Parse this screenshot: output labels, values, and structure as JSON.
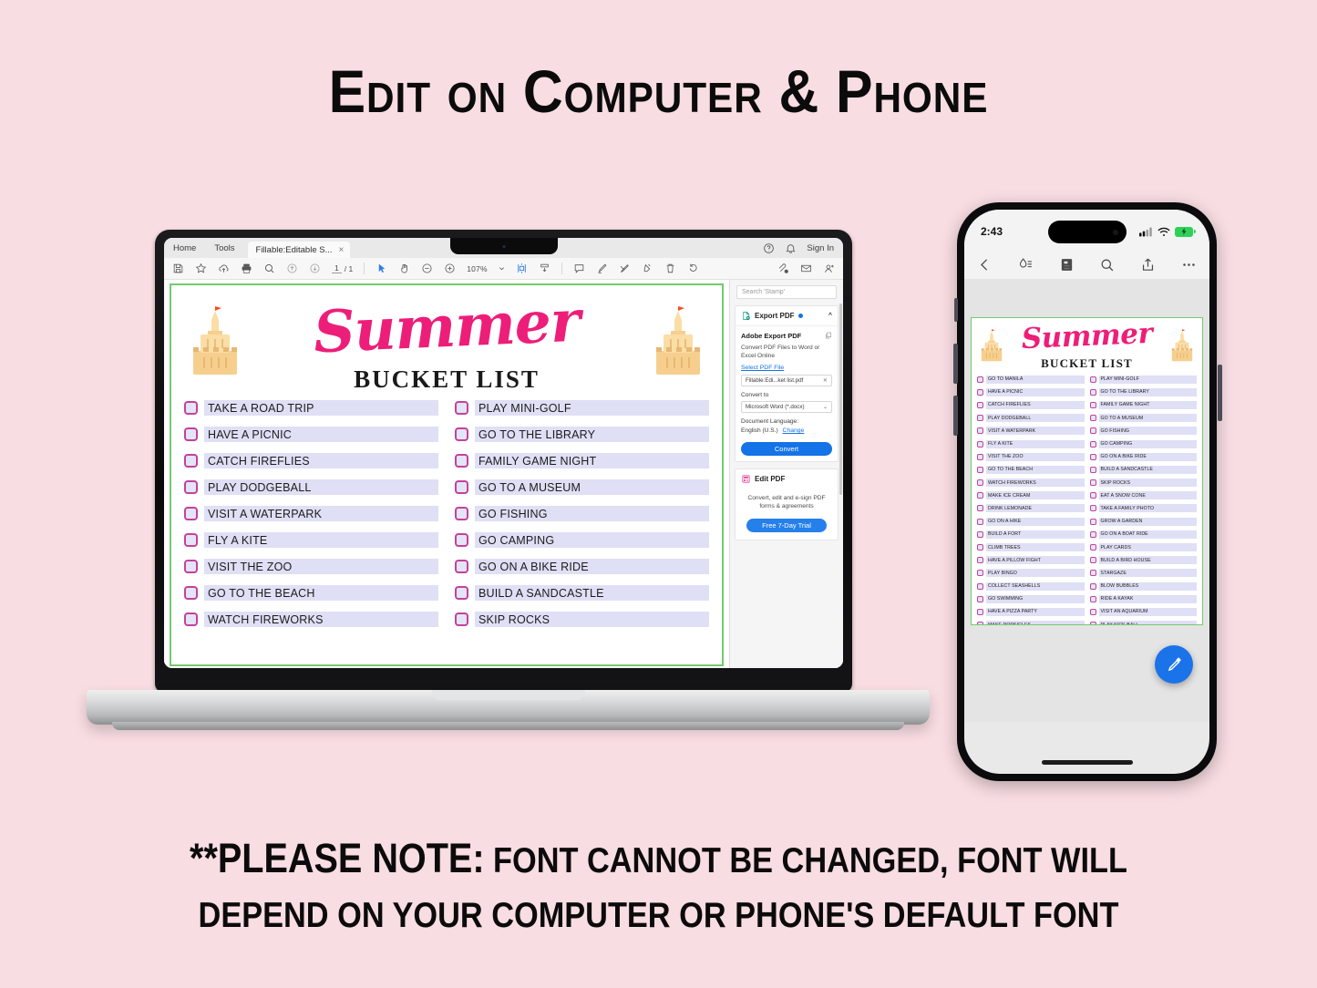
{
  "page": {
    "background_color": "#f8dde2",
    "headline": "Edit on Computer & Phone",
    "footnote_line1_bold": "**PLEASE NOTE:",
    "footnote_line1_rest": " FONT CANNOT BE CHANGED, FONT WILL",
    "footnote_line2": "DEPEND ON YOUR COMPUTER OR PHONE'S DEFAULT FONT"
  },
  "laptop": {
    "app": {
      "tabbar": {
        "menu_home": "Home",
        "menu_tools": "Tools",
        "doc_tab_label": "Fillable:Editable S...",
        "doc_tab_close": "×",
        "help_icon": "help-circle-icon",
        "bell_icon": "bell-icon",
        "sign_in": "Sign In"
      },
      "toolbar": {
        "save_icon": "save-icon",
        "star_icon": "star-icon",
        "upload_icon": "cloud-upload-icon",
        "print_icon": "print-icon",
        "search_icon": "search-icon",
        "prev_page_icon": "arrow-up-circle-icon",
        "next_page_icon": "arrow-down-circle-icon",
        "page_current": "1",
        "page_total": "/ 1",
        "select_icon": "cursor-select-icon",
        "hand_icon": "hand-pan-icon",
        "zoom_out_icon": "zoom-out-icon",
        "zoom_in_icon": "zoom-in-icon",
        "zoom_level": "107%",
        "zoom_dropdown_icon": "chevron-down-icon",
        "fit_page_icon": "fit-page-icon",
        "scroll_mode_icon": "scroll-mode-icon",
        "comment_icon": "comment-icon",
        "highlight_icon": "highlight-pen-icon",
        "draw_icon": "draw-icon",
        "fill_sign_icon": "fill-sign-icon",
        "delete_icon": "trash-icon",
        "rotate_icon": "rotate-icon",
        "attach_icon": "attach-icon",
        "email_icon": "email-icon",
        "person_icon": "person-add-icon"
      }
    },
    "rail": {
      "search_placeholder": "Search 'Stamp'",
      "export_panel": {
        "icon": "export-pdf-icon",
        "title": "Export PDF",
        "status_dot": "status-dot",
        "collapse_icon": "chevron-up-icon",
        "heading": "Adobe Export PDF",
        "copy_icon": "copy-icon",
        "description": "Convert PDF Files to Word or Excel Online",
        "select_link": "Select PDF File",
        "file_name": "Fillable:Edi...ket list.pdf",
        "file_clear_icon": "close-icon",
        "convert_to_label": "Convert to",
        "convert_to_value": "Microsoft Word (*.docx)",
        "convert_dropdown_icon": "chevron-down-icon",
        "doc_language_label": "Document Language:",
        "doc_language_value": "English (U.S.)",
        "change_link": "Change",
        "convert_button": "Convert"
      },
      "edit_panel": {
        "icon": "edit-pdf-icon",
        "title": "Edit PDF",
        "description": "Convert, edit and e-sign PDF forms & agreements",
        "trial_button": "Free 7-Day Trial"
      }
    },
    "document": {
      "title_script": "Summer",
      "title_sub": "BUCKET LIST",
      "border_color": "#72cb6b",
      "checkbox_border_color": "#c2429b",
      "field_fill_color": "#dfdff5",
      "script_color": "#ed1e79",
      "left_column": [
        "TAKE A ROAD TRIP",
        "HAVE A PICNIC",
        "CATCH FIREFLIES",
        "PLAY DODGEBALL",
        "VISIT A WATERPARK",
        "FLY A KITE",
        "VISIT THE ZOO",
        "GO TO THE BEACH",
        "WATCH FIREWORKS"
      ],
      "right_column": [
        "PLAY MINI-GOLF",
        "GO TO THE LIBRARY",
        "FAMILY GAME NIGHT",
        "GO TO A MUSEUM",
        "GO FISHING",
        "GO CAMPING",
        "GO ON A BIKE RIDE",
        "BUILD A SANDCASTLE",
        "SKIP ROCKS"
      ]
    }
  },
  "phone": {
    "status": {
      "time": "2:43",
      "cellular_icon": "cellular-bars-icon",
      "wifi_icon": "wifi-icon",
      "battery_icon": "battery-charging-icon"
    },
    "toolbar": {
      "back_icon": "chevron-left-icon",
      "reading_mode_icon": "reading-mode-icon",
      "pages_icon": "page-thumbnails-icon",
      "search_icon": "search-icon",
      "share_icon": "share-icon",
      "more_icon": "more-horizontal-icon"
    },
    "fab_icon": "edit-pencil-icon",
    "fab_color": "#1a73e8",
    "document": {
      "title_script": "Summer",
      "title_sub": "BUCKET LIST",
      "left_column": [
        "GO TO MANILA",
        "HAVE A PICNIC",
        "CATCH FIREFLIES",
        "PLAY DODGEBALL",
        "VISIT A WATERPARK",
        "FLY A KITE",
        "VISIT THE ZOO",
        "GO TO THE BEACH",
        "WATCH FIREWORKS",
        "MAKE ICE CREAM",
        "DRINK LEMONADE",
        "GO ON A HIKE",
        "BUILD A FORT",
        "CLIMB TREES",
        "HAVE A PILLOW FIGHT",
        "PLAY BINGO",
        "COLLECT SEASHELLS",
        "GO SWIMMING",
        "HAVE A PIZZA PARTY",
        "MAKE POPSICLES"
      ],
      "right_column": [
        "PLAY MINI-GOLF",
        "GO TO THE LIBRARY",
        "FAMILY GAME NIGHT",
        "GO TO A MUSEUM",
        "GO FISHING",
        "GO CAMPING",
        "GO ON A BIKE RIDE",
        "BUILD A SANDCASTLE",
        "SKIP ROCKS",
        "EAT A SNOW CONE",
        "TAKE A FAMILY PHOTO",
        "GROW A GARDEN",
        "GO ON A BOAT RIDE",
        "PLAY CARDS",
        "BUILD A BIRD HOUSE",
        "STARGAZE",
        "BLOW BUBBLES",
        "RIDE A KAYAK",
        "VISIT AN AQUARIUM",
        "PLAY KICK BALL"
      ]
    }
  }
}
